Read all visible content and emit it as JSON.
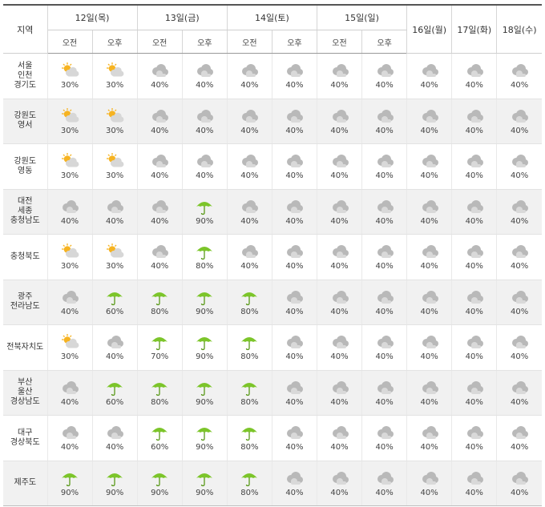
{
  "header": {
    "region_label": "지역",
    "am_label": "오전",
    "pm_label": "오후",
    "days_split": [
      "12일(목)",
      "13일(금)",
      "14일(토)",
      "15일(일)"
    ],
    "days_single": [
      "16일(월)",
      "17일(화)",
      "18일(수)"
    ]
  },
  "rows": [
    {
      "region": "서울\n인천\n경기도",
      "cells": [
        {
          "icon": "partly-cloudy-icon",
          "pct": "30%"
        },
        {
          "icon": "partly-cloudy-icon",
          "pct": "30%"
        },
        {
          "icon": "cloudy-icon",
          "pct": "40%"
        },
        {
          "icon": "cloudy-icon",
          "pct": "40%"
        },
        {
          "icon": "cloudy-icon",
          "pct": "40%"
        },
        {
          "icon": "cloudy-icon",
          "pct": "40%"
        },
        {
          "icon": "cloudy-icon",
          "pct": "40%"
        },
        {
          "icon": "cloudy-icon",
          "pct": "40%"
        },
        {
          "icon": "cloudy-icon",
          "pct": "40%"
        },
        {
          "icon": "cloudy-icon",
          "pct": "40%"
        },
        {
          "icon": "cloudy-icon",
          "pct": "40%"
        }
      ]
    },
    {
      "region": "강원도\n영서",
      "cells": [
        {
          "icon": "partly-cloudy-icon",
          "pct": "30%"
        },
        {
          "icon": "partly-cloudy-icon",
          "pct": "30%"
        },
        {
          "icon": "cloudy-icon",
          "pct": "40%"
        },
        {
          "icon": "cloudy-icon",
          "pct": "40%"
        },
        {
          "icon": "cloudy-icon",
          "pct": "40%"
        },
        {
          "icon": "cloudy-icon",
          "pct": "40%"
        },
        {
          "icon": "cloudy-icon",
          "pct": "40%"
        },
        {
          "icon": "cloudy-icon",
          "pct": "40%"
        },
        {
          "icon": "cloudy-icon",
          "pct": "40%"
        },
        {
          "icon": "cloudy-icon",
          "pct": "40%"
        },
        {
          "icon": "cloudy-icon",
          "pct": "40%"
        }
      ]
    },
    {
      "region": "강원도\n영동",
      "cells": [
        {
          "icon": "partly-cloudy-icon",
          "pct": "30%"
        },
        {
          "icon": "partly-cloudy-icon",
          "pct": "30%"
        },
        {
          "icon": "cloudy-icon",
          "pct": "40%"
        },
        {
          "icon": "cloudy-icon",
          "pct": "40%"
        },
        {
          "icon": "cloudy-icon",
          "pct": "40%"
        },
        {
          "icon": "cloudy-icon",
          "pct": "40%"
        },
        {
          "icon": "cloudy-icon",
          "pct": "40%"
        },
        {
          "icon": "cloudy-icon",
          "pct": "40%"
        },
        {
          "icon": "cloudy-icon",
          "pct": "40%"
        },
        {
          "icon": "cloudy-icon",
          "pct": "40%"
        },
        {
          "icon": "cloudy-icon",
          "pct": "40%"
        }
      ]
    },
    {
      "region": "대전\n세종\n충청남도",
      "cells": [
        {
          "icon": "cloudy-icon",
          "pct": "40%"
        },
        {
          "icon": "cloudy-icon",
          "pct": "40%"
        },
        {
          "icon": "cloudy-icon",
          "pct": "40%"
        },
        {
          "icon": "umbrella-icon",
          "pct": "90%"
        },
        {
          "icon": "cloudy-icon",
          "pct": "40%"
        },
        {
          "icon": "cloudy-icon",
          "pct": "40%"
        },
        {
          "icon": "cloudy-icon",
          "pct": "40%"
        },
        {
          "icon": "cloudy-icon",
          "pct": "40%"
        },
        {
          "icon": "cloudy-icon",
          "pct": "40%"
        },
        {
          "icon": "cloudy-icon",
          "pct": "40%"
        },
        {
          "icon": "cloudy-icon",
          "pct": "40%"
        }
      ]
    },
    {
      "region": "충청북도",
      "cells": [
        {
          "icon": "partly-cloudy-icon",
          "pct": "30%"
        },
        {
          "icon": "partly-cloudy-icon",
          "pct": "30%"
        },
        {
          "icon": "cloudy-icon",
          "pct": "40%"
        },
        {
          "icon": "umbrella-icon",
          "pct": "80%"
        },
        {
          "icon": "cloudy-icon",
          "pct": "40%"
        },
        {
          "icon": "cloudy-icon",
          "pct": "40%"
        },
        {
          "icon": "cloudy-icon",
          "pct": "40%"
        },
        {
          "icon": "cloudy-icon",
          "pct": "40%"
        },
        {
          "icon": "cloudy-icon",
          "pct": "40%"
        },
        {
          "icon": "cloudy-icon",
          "pct": "40%"
        },
        {
          "icon": "cloudy-icon",
          "pct": "40%"
        }
      ]
    },
    {
      "region": "광주\n전라남도",
      "cells": [
        {
          "icon": "cloudy-icon",
          "pct": "40%"
        },
        {
          "icon": "umbrella-icon",
          "pct": "60%"
        },
        {
          "icon": "umbrella-icon",
          "pct": "80%"
        },
        {
          "icon": "umbrella-icon",
          "pct": "90%"
        },
        {
          "icon": "umbrella-icon",
          "pct": "80%"
        },
        {
          "icon": "cloudy-icon",
          "pct": "40%"
        },
        {
          "icon": "cloudy-icon",
          "pct": "40%"
        },
        {
          "icon": "cloudy-icon",
          "pct": "40%"
        },
        {
          "icon": "cloudy-icon",
          "pct": "40%"
        },
        {
          "icon": "cloudy-icon",
          "pct": "40%"
        },
        {
          "icon": "cloudy-icon",
          "pct": "40%"
        }
      ]
    },
    {
      "region": "전북자치도",
      "cells": [
        {
          "icon": "partly-cloudy-icon",
          "pct": "30%"
        },
        {
          "icon": "cloudy-icon",
          "pct": "40%"
        },
        {
          "icon": "umbrella-icon",
          "pct": "70%"
        },
        {
          "icon": "umbrella-icon",
          "pct": "90%"
        },
        {
          "icon": "umbrella-icon",
          "pct": "80%"
        },
        {
          "icon": "cloudy-icon",
          "pct": "40%"
        },
        {
          "icon": "cloudy-icon",
          "pct": "40%"
        },
        {
          "icon": "cloudy-icon",
          "pct": "40%"
        },
        {
          "icon": "cloudy-icon",
          "pct": "40%"
        },
        {
          "icon": "cloudy-icon",
          "pct": "40%"
        },
        {
          "icon": "cloudy-icon",
          "pct": "40%"
        }
      ]
    },
    {
      "region": "부산\n울산\n경상남도",
      "cells": [
        {
          "icon": "cloudy-icon",
          "pct": "40%"
        },
        {
          "icon": "umbrella-icon",
          "pct": "60%"
        },
        {
          "icon": "umbrella-icon",
          "pct": "80%"
        },
        {
          "icon": "umbrella-icon",
          "pct": "90%"
        },
        {
          "icon": "umbrella-icon",
          "pct": "80%"
        },
        {
          "icon": "cloudy-icon",
          "pct": "40%"
        },
        {
          "icon": "cloudy-icon",
          "pct": "40%"
        },
        {
          "icon": "cloudy-icon",
          "pct": "40%"
        },
        {
          "icon": "cloudy-icon",
          "pct": "40%"
        },
        {
          "icon": "cloudy-icon",
          "pct": "40%"
        },
        {
          "icon": "cloudy-icon",
          "pct": "40%"
        }
      ]
    },
    {
      "region": "대구\n경상북도",
      "cells": [
        {
          "icon": "cloudy-icon",
          "pct": "40%"
        },
        {
          "icon": "cloudy-icon",
          "pct": "40%"
        },
        {
          "icon": "umbrella-icon",
          "pct": "60%"
        },
        {
          "icon": "umbrella-icon",
          "pct": "90%"
        },
        {
          "icon": "umbrella-icon",
          "pct": "80%"
        },
        {
          "icon": "cloudy-icon",
          "pct": "40%"
        },
        {
          "icon": "cloudy-icon",
          "pct": "40%"
        },
        {
          "icon": "cloudy-icon",
          "pct": "40%"
        },
        {
          "icon": "cloudy-icon",
          "pct": "40%"
        },
        {
          "icon": "cloudy-icon",
          "pct": "40%"
        },
        {
          "icon": "cloudy-icon",
          "pct": "40%"
        }
      ]
    },
    {
      "region": "제주도",
      "cells": [
        {
          "icon": "umbrella-icon",
          "pct": "90%"
        },
        {
          "icon": "umbrella-icon",
          "pct": "90%"
        },
        {
          "icon": "umbrella-icon",
          "pct": "90%"
        },
        {
          "icon": "umbrella-icon",
          "pct": "90%"
        },
        {
          "icon": "umbrella-icon",
          "pct": "80%"
        },
        {
          "icon": "cloudy-icon",
          "pct": "40%"
        },
        {
          "icon": "cloudy-icon",
          "pct": "40%"
        },
        {
          "icon": "cloudy-icon",
          "pct": "40%"
        },
        {
          "icon": "cloudy-icon",
          "pct": "40%"
        },
        {
          "icon": "cloudy-icon",
          "pct": "40%"
        },
        {
          "icon": "cloudy-icon",
          "pct": "40%"
        }
      ]
    }
  ],
  "colors": {
    "umbrella": "#7cc52a",
    "cloud": "#b9b9b9",
    "sun": "#f6b321",
    "row_alt_bg": "#f1f1f1"
  }
}
